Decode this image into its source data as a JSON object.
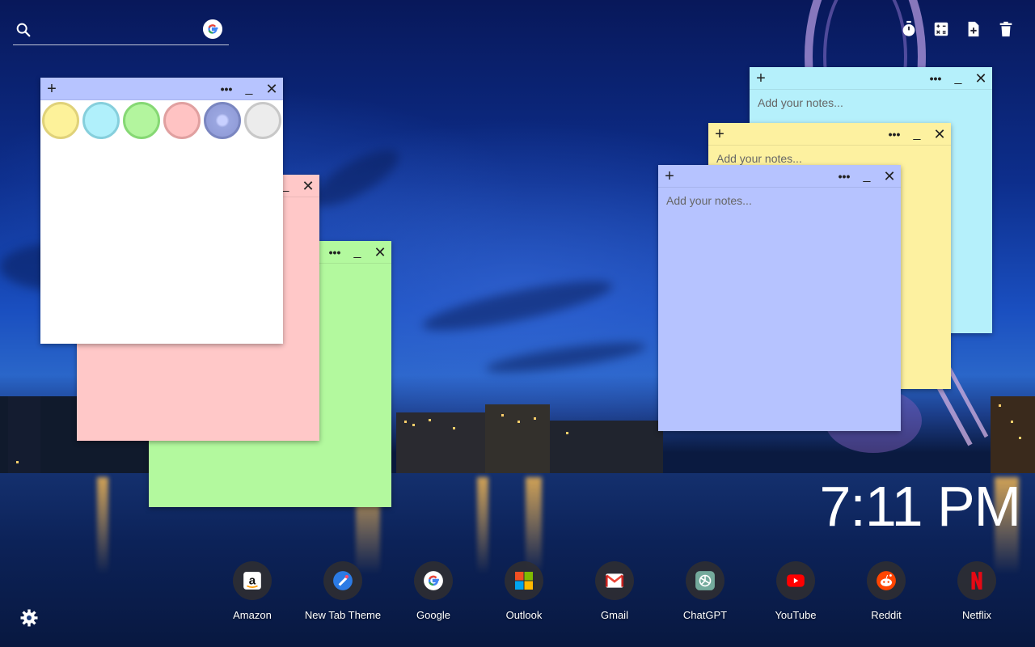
{
  "search": {
    "placeholder": "",
    "icon": "search-icon",
    "engine_icon": "google-icon"
  },
  "toolbar": [
    {
      "name": "timer-button",
      "icon": "stopwatch-icon"
    },
    {
      "name": "calculator-button",
      "icon": "calculator-icon"
    },
    {
      "name": "new-note-button",
      "icon": "add-note-icon"
    },
    {
      "name": "delete-button",
      "icon": "trash-icon"
    }
  ],
  "notes": {
    "add_label": "+",
    "more_label": "•••",
    "minimize_label": "_",
    "close_label": "✕",
    "placeholder": "Add your notes...",
    "colors": {
      "white": "#ffffff",
      "pink": "#ffc8c8",
      "green": "#b3f99e",
      "cyan": "#b5f0fb",
      "yellow": "#fdf1a0",
      "lavender": "#b6c3ff",
      "lavender_bar": "#b7c4ff"
    },
    "swatches": [
      {
        "name": "yellow",
        "color": "#fdf29a",
        "border": "#e0d27a"
      },
      {
        "name": "cyan",
        "color": "#b0f0fb",
        "border": "#86cfdc"
      },
      {
        "name": "green",
        "color": "#b3f59e",
        "border": "#86d874"
      },
      {
        "name": "pink",
        "color": "#ffc3c3",
        "border": "#e0a0a0"
      },
      {
        "name": "lavender",
        "color": "#9aa6e0",
        "border": "#7a86c0"
      },
      {
        "name": "gray",
        "color": "#ececec",
        "border": "#c8c8c8"
      }
    ]
  },
  "clock": {
    "time": "7:11 PM"
  },
  "shortcuts": [
    {
      "label": "Amazon",
      "icon": "amazon-icon"
    },
    {
      "label": "New Tab Theme",
      "icon": "new-tab-theme-icon"
    },
    {
      "label": "Google",
      "icon": "google-icon"
    },
    {
      "label": "Outlook",
      "icon": "microsoft-icon"
    },
    {
      "label": "Gmail",
      "icon": "gmail-icon"
    },
    {
      "label": "ChatGPT",
      "icon": "chatgpt-icon"
    },
    {
      "label": "YouTube",
      "icon": "youtube-icon"
    },
    {
      "label": "Reddit",
      "icon": "reddit-icon"
    },
    {
      "label": "Netflix",
      "icon": "netflix-icon"
    }
  ],
  "settings": {
    "icon": "gear-icon"
  }
}
